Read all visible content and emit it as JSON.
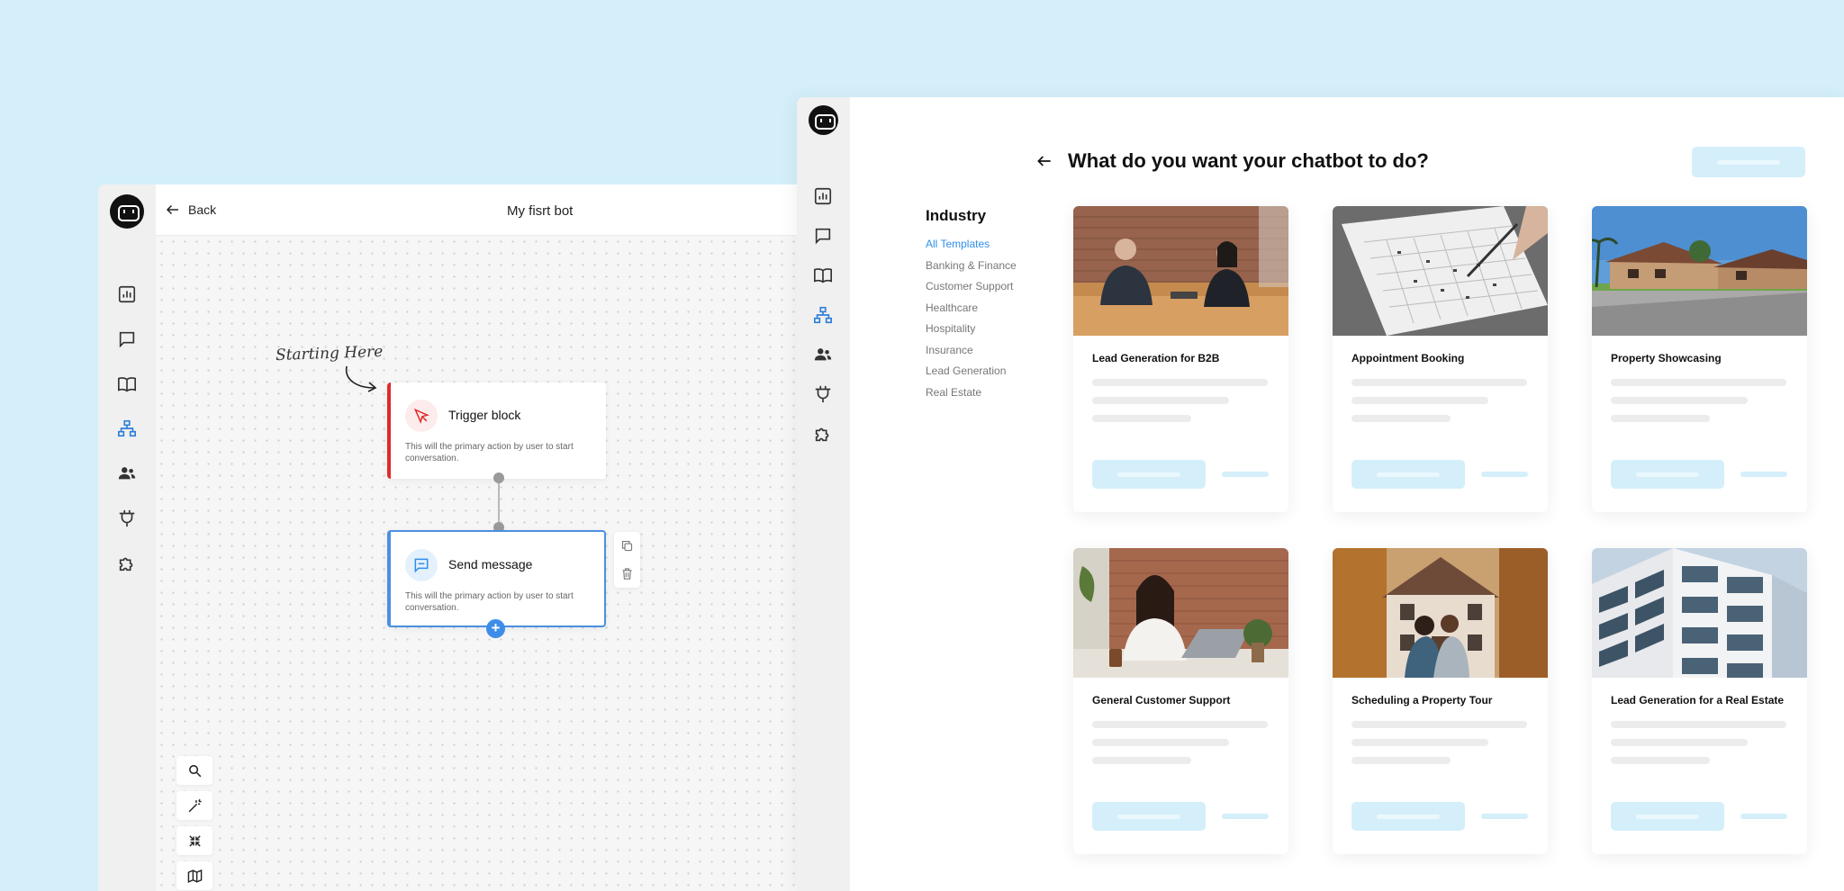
{
  "builder": {
    "back_label": "Back",
    "bot_title": "My fisrt bot",
    "start_note": "Starting Here",
    "trigger": {
      "title": "Trigger block",
      "description": "This will the primary action by user to start conversation.",
      "accent": "#e02a2a"
    },
    "send_message": {
      "title": "Send message",
      "description": "This will the primary action by user to start conversation.",
      "accent": "#4a90e2"
    },
    "rail_icons": [
      "analytics-icon",
      "chat-icon",
      "book-icon",
      "flow-icon",
      "users-icon",
      "plug-icon",
      "puzzle-icon"
    ],
    "zoom_tools": [
      "search-icon",
      "magic-wand-icon",
      "collapse-icon",
      "map-icon"
    ]
  },
  "templates": {
    "title": "What do you want your chatbot to do?",
    "industry_heading": "Industry",
    "industries": [
      {
        "label": "All Templates",
        "active": true
      },
      {
        "label": "Banking & Finance",
        "active": false
      },
      {
        "label": "Customer Support",
        "active": false
      },
      {
        "label": "Healthcare",
        "active": false
      },
      {
        "label": "Hospitality",
        "active": false
      },
      {
        "label": "Insurance",
        "active": false
      },
      {
        "label": "Lead Generation",
        "active": false
      },
      {
        "label": "Real Estate",
        "active": false
      }
    ],
    "cards": [
      {
        "title": "Lead Generation for B2B",
        "image": "office-meeting"
      },
      {
        "title": "Appointment Booking",
        "image": "calendar"
      },
      {
        "title": "Property Showcasing",
        "image": "houses-street"
      },
      {
        "title": "General Customer Support",
        "image": "woman-laptop"
      },
      {
        "title": "Scheduling a Property Tour",
        "image": "couple-house"
      },
      {
        "title": "Lead Generation for a Real Estate",
        "image": "apartment-building"
      }
    ]
  },
  "colors": {
    "background": "#d4effa",
    "accent_blue": "#2f8ee8",
    "trigger_red": "#e02a2a"
  }
}
